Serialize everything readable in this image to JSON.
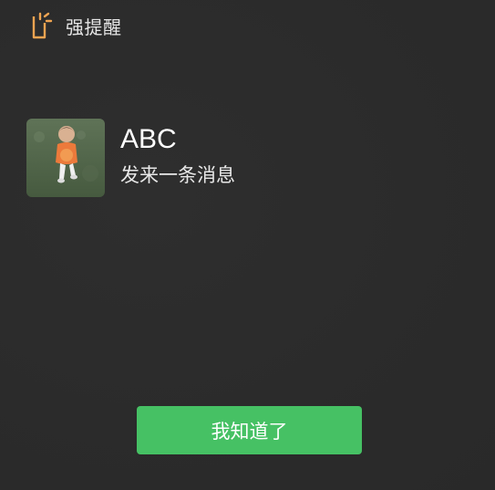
{
  "colors": {
    "accent": "#46c164",
    "background": "#2c2c2c",
    "icon": "#f0a451"
  },
  "header": {
    "icon": "reminder-bell-icon",
    "title": "强提醒"
  },
  "notification": {
    "avatar": "baby-photo-avatar",
    "sender": "ABC",
    "message": "发来一条消息"
  },
  "actions": {
    "ack_label": "我知道了"
  }
}
